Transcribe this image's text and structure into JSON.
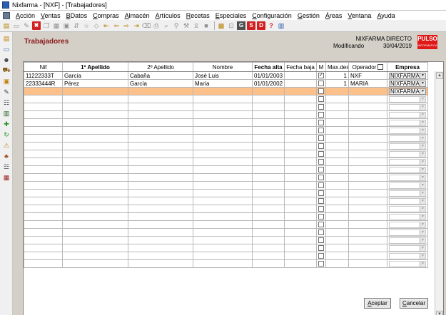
{
  "window": {
    "title": "Nixfarma - [NXF] - [Trabajadores]"
  },
  "menu": [
    "Acción",
    "Ventas",
    "BDatos",
    "Compras",
    "Almacén",
    "Artículos",
    "Recetas",
    "Especiales",
    "Configuración",
    "Gestión",
    "Áreas",
    "Ventana",
    "Ayuda"
  ],
  "toolbar": {
    "save_icon": "save-icon",
    "calc_icon": "calculator-icon",
    "exit_icon": "exit-icon",
    "s_label": "S",
    "d_label": "D",
    "help_label": "?"
  },
  "header": {
    "title": "Trabajadores",
    "pharmacy": "NIXFARMA DIRECTO",
    "status": "Modificando",
    "date": "30/04/2019",
    "logo": "PULSO",
    "logo_sub": "INFORMATICA"
  },
  "grid": {
    "columns": [
      "Nif",
      "1º Apellido",
      "2º Apellido",
      "Nombre",
      "Fecha alta",
      "Fecha baja",
      "M",
      "Max.des.",
      "Operador",
      "Empresa"
    ],
    "rows": [
      {
        "nif": "11222333T",
        "apellido1": "García",
        "apellido2": "Cabaña",
        "nombre": "José Luis",
        "fecha_alta": "01/01/2003",
        "fecha_baja": "",
        "m": true,
        "max_des": "1",
        "operador": "NXF",
        "empresa": "NIXFARMA"
      },
      {
        "nif": "22333444R",
        "apellido1": "Pérez",
        "apellido2": "García",
        "nombre": "María",
        "fecha_alta": "01/01/2002",
        "fecha_baja": "",
        "m": false,
        "max_des": "1",
        "operador": "MARIA",
        "empresa": "NIXFARMA"
      },
      {
        "nif": "",
        "apellido1": "",
        "apellido2": "",
        "nombre": "",
        "fecha_alta": "",
        "fecha_baja": "",
        "m": false,
        "max_des": "",
        "operador": "",
        "empresa": "NIXFARMA"
      }
    ],
    "empty_rows": 22,
    "selected_row": 2,
    "selected_color": "#fcc08a"
  },
  "buttons": {
    "accept": "Aceptar",
    "cancel": "Cancelar"
  }
}
